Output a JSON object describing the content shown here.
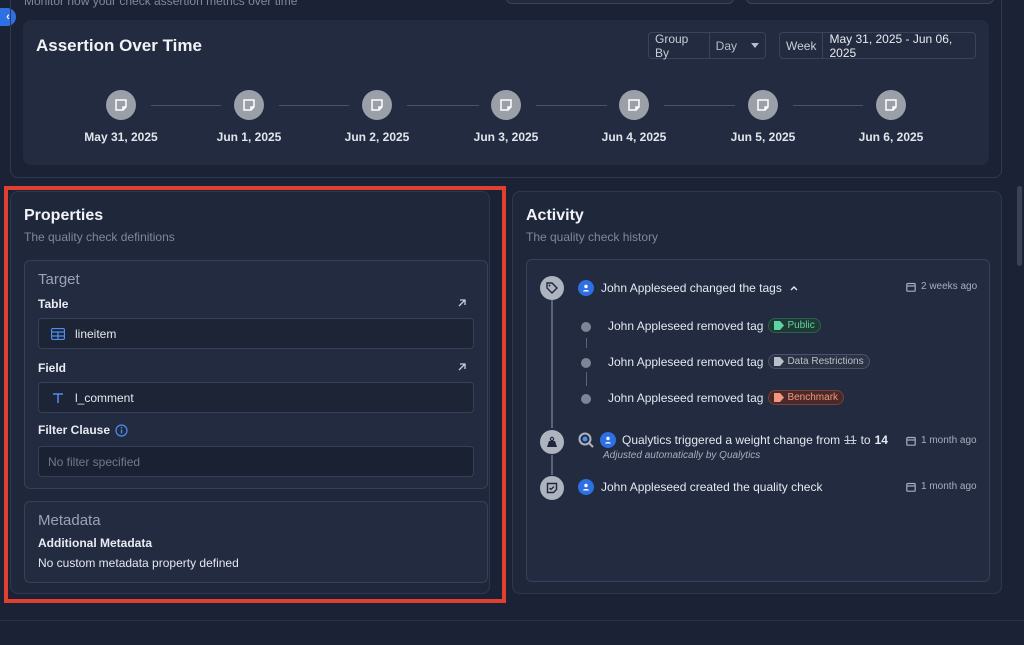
{
  "header": {
    "subtitle": "Monitor how your check assertion metrics over time"
  },
  "assertion_over_time": {
    "title": "Assertion Over Time",
    "group_by_label": "Group By",
    "group_by_value": "Day",
    "week_label": "Week",
    "week_value": "May 31, 2025 - Jun 06, 2025",
    "dates": [
      "May 31, 2025",
      "Jun 1, 2025",
      "Jun 2, 2025",
      "Jun 3, 2025",
      "Jun 4, 2025",
      "Jun 5, 2025",
      "Jun 6, 2025"
    ]
  },
  "properties": {
    "title": "Properties",
    "subtitle": "The quality check definitions",
    "target": {
      "title": "Target",
      "table_label": "Table",
      "table_value": "lineitem",
      "field_label": "Field",
      "field_value": "l_comment",
      "filter_label": "Filter Clause",
      "filter_placeholder": "No filter specified"
    },
    "metadata": {
      "title": "Metadata",
      "additional_label": "Additional Metadata",
      "additional_value": "No custom metadata property defined"
    }
  },
  "activity": {
    "title": "Activity",
    "subtitle": "The quality check history",
    "events": [
      {
        "text": "John Appleseed changed the tags",
        "time": "2 weeks ago",
        "sub": [
          {
            "text": "John Appleseed removed tag",
            "tag": "Public"
          },
          {
            "text": "John Appleseed removed tag",
            "tag": "Data Restrictions"
          },
          {
            "text": "John Appleseed removed tag",
            "tag": "Benchmark"
          }
        ]
      },
      {
        "text_prefix": "Qualytics triggered a weight change from",
        "old_value": "11",
        "to": "to",
        "new_value": "14",
        "note": "Adjusted automatically by Qualytics",
        "time": "1 month ago"
      },
      {
        "text": "John Appleseed created the quality check",
        "time": "1 month ago"
      }
    ]
  },
  "colors": {
    "accent": "#2f6fe4",
    "highlight": "#e0402f",
    "tag_public": "#5fd3a3",
    "tag_benchmark": "#f2977e"
  }
}
